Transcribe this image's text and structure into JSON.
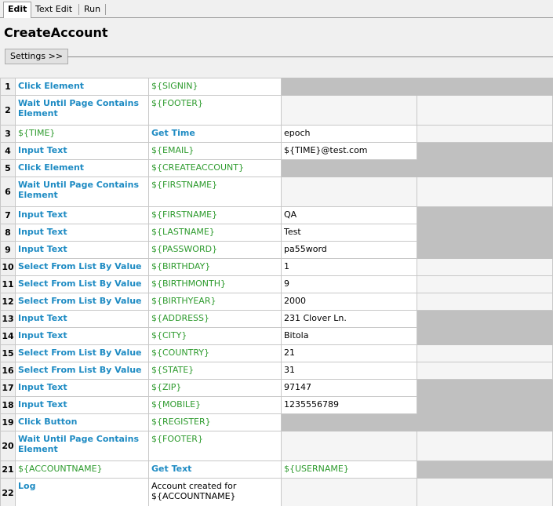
{
  "tabs": [
    "Edit",
    "Text Edit",
    "Run"
  ],
  "title": "CreateAccount",
  "settings_label": "Settings >>",
  "rows": [
    {
      "n": "1",
      "a": "Click Element",
      "at": "kw",
      "b": "${SIGNIN}",
      "bt": "var",
      "c": "",
      "ct": "",
      "tall": false,
      "fill": "gray-span"
    },
    {
      "n": "2",
      "a": "Wait Until Page Contains Element",
      "at": "kw",
      "b": "${FOOTER}",
      "bt": "var",
      "c": "",
      "ct": "",
      "tall": true,
      "fill": "light"
    },
    {
      "n": "3",
      "a": "${TIME}",
      "at": "var",
      "b": "Get Time",
      "bt": "kw",
      "c": "epoch",
      "ct": "txt",
      "tall": false,
      "fill": "light4"
    },
    {
      "n": "4",
      "a": "Input Text",
      "at": "kw",
      "b": "${EMAIL}",
      "bt": "var",
      "c": "${TIME}@test.com",
      "ct": "txt",
      "tall": false,
      "fill": "gray4"
    },
    {
      "n": "5",
      "a": "Click Element",
      "at": "kw",
      "b": "${CREATEACCOUNT}",
      "bt": "var",
      "c": "",
      "ct": "",
      "tall": false,
      "fill": "gray-span"
    },
    {
      "n": "6",
      "a": "Wait Until Page Contains Element",
      "at": "kw",
      "b": "${FIRSTNAME}",
      "bt": "var",
      "c": "",
      "ct": "",
      "tall": true,
      "fill": "light"
    },
    {
      "n": "7",
      "a": "Input Text",
      "at": "kw",
      "b": "${FIRSTNAME}",
      "bt": "var",
      "c": "QA",
      "ct": "txt",
      "tall": false,
      "fill": "gray4"
    },
    {
      "n": "8",
      "a": "Input Text",
      "at": "kw",
      "b": "${LASTNAME}",
      "bt": "var",
      "c": "Test",
      "ct": "txt",
      "tall": false,
      "fill": "gray4"
    },
    {
      "n": "9",
      "a": "Input Text",
      "at": "kw",
      "b": "${PASSWORD}",
      "bt": "var",
      "c": "pa55word",
      "ct": "txt",
      "tall": false,
      "fill": "gray4"
    },
    {
      "n": "10",
      "a": "Select From List By Value",
      "at": "kw",
      "b": "${BIRTHDAY}",
      "bt": "var",
      "c": "1",
      "ct": "txt",
      "tall": false,
      "fill": "light4"
    },
    {
      "n": "11",
      "a": "Select From List By Value",
      "at": "kw",
      "b": "${BIRTHMONTH}",
      "bt": "var",
      "c": "9",
      "ct": "txt",
      "tall": false,
      "fill": "light4"
    },
    {
      "n": "12",
      "a": "Select From List By Value",
      "at": "kw",
      "b": "${BIRTHYEAR}",
      "bt": "var",
      "c": "2000",
      "ct": "txt",
      "tall": false,
      "fill": "light4"
    },
    {
      "n": "13",
      "a": "Input Text",
      "at": "kw",
      "b": "${ADDRESS}",
      "bt": "var",
      "c": "231 Clover Ln.",
      "ct": "txt",
      "tall": false,
      "fill": "gray4"
    },
    {
      "n": "14",
      "a": "Input Text",
      "at": "kw",
      "b": "${CITY}",
      "bt": "var",
      "c": "Bitola",
      "ct": "txt",
      "tall": false,
      "fill": "gray4"
    },
    {
      "n": "15",
      "a": "Select From List By Value",
      "at": "kw",
      "b": "${COUNTRY}",
      "bt": "var",
      "c": "21",
      "ct": "txt",
      "tall": false,
      "fill": "light4"
    },
    {
      "n": "16",
      "a": "Select From List By Value",
      "at": "kw",
      "b": "${STATE}",
      "bt": "var",
      "c": "31",
      "ct": "txt",
      "tall": false,
      "fill": "light4"
    },
    {
      "n": "17",
      "a": "Input Text",
      "at": "kw",
      "b": "${ZIP}",
      "bt": "var",
      "c": "97147",
      "ct": "txt",
      "tall": false,
      "fill": "gray4"
    },
    {
      "n": "18",
      "a": "Input Text",
      "at": "kw",
      "b": "${MOBILE}",
      "bt": "var",
      "c": "1235556789",
      "ct": "txt",
      "tall": false,
      "fill": "gray4"
    },
    {
      "n": "19",
      "a": "Click Button",
      "at": "kw",
      "b": "${REGISTER}",
      "bt": "var",
      "c": "",
      "ct": "",
      "tall": false,
      "fill": "gray-span"
    },
    {
      "n": "20",
      "a": "Wait Until Page Contains Element",
      "at": "kw",
      "b": "${FOOTER}",
      "bt": "var",
      "c": "",
      "ct": "",
      "tall": true,
      "fill": "light"
    },
    {
      "n": "21",
      "a": "${ACCOUNTNAME}",
      "at": "var",
      "b": "Get Text",
      "bt": "kw",
      "c": "${USERNAME}",
      "ct": "var",
      "tall": false,
      "fill": "gray4"
    },
    {
      "n": "22",
      "a": "Log",
      "at": "kw",
      "b": "Account created for ${ACCOUNTNAME}",
      "bt": "txt",
      "c": "",
      "ct": "",
      "tall": true,
      "fill": "light"
    }
  ]
}
